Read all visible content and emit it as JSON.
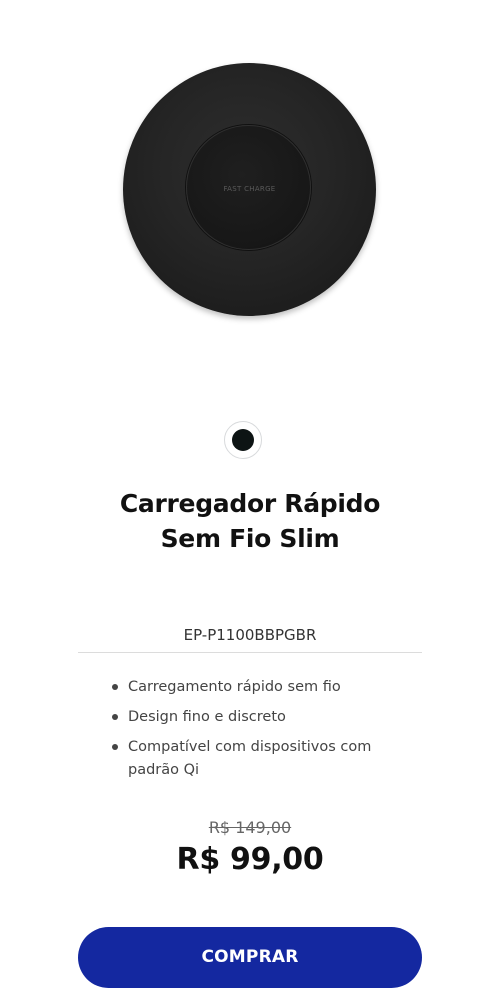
{
  "product": {
    "image_text": "FAST CHARGE",
    "swatch_color": "#0d1414",
    "title_line1": "Carregador Rápido",
    "title_line2": "Sem Fio Slim",
    "model_code": "EP-P1100BBPGBR",
    "features": [
      "Carregamento rápido sem fio",
      "Design fino e discreto",
      "Compatível com dispositivos com padrão Qi"
    ],
    "old_price": "R$ 149,00",
    "price": "R$ 99,00"
  },
  "actions": {
    "buy_label": "COMPRAR"
  },
  "colors": {
    "accent": "#1428a0",
    "background": "#ffffff",
    "text": "#111111"
  }
}
